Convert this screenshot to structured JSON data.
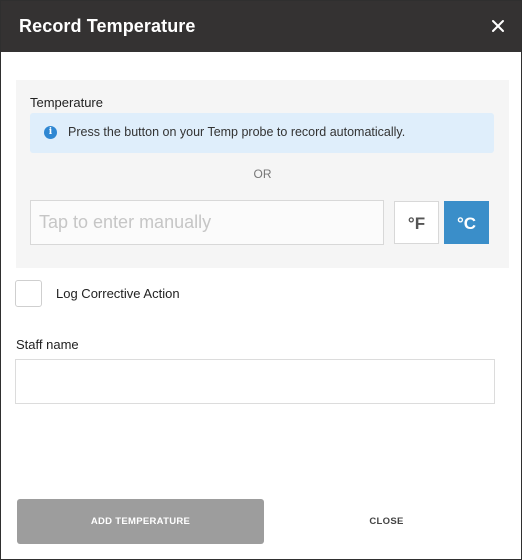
{
  "dialog": {
    "title": "Record Temperature",
    "close_icon": "close-icon"
  },
  "temperature": {
    "label": "Temperature",
    "info_icon": "info-icon",
    "info_text": "Press the button on your Temp probe to record automatically.",
    "or_text": "OR",
    "manual_placeholder": "Tap to enter manually",
    "manual_value": "",
    "units": [
      {
        "label": "°F",
        "selected": false
      },
      {
        "label": "°C",
        "selected": true
      }
    ]
  },
  "corrective": {
    "label": "Log Corrective Action",
    "checked": false
  },
  "staff": {
    "label": "Staff name",
    "value": ""
  },
  "actions": {
    "add_label": "ADD TEMPERATURE",
    "close_label": "CLOSE"
  },
  "colors": {
    "header_bg": "#343232",
    "accent": "#3a8ec9",
    "info_bg": "#dfeefb",
    "disabled_button": "#9d9d9d"
  }
}
